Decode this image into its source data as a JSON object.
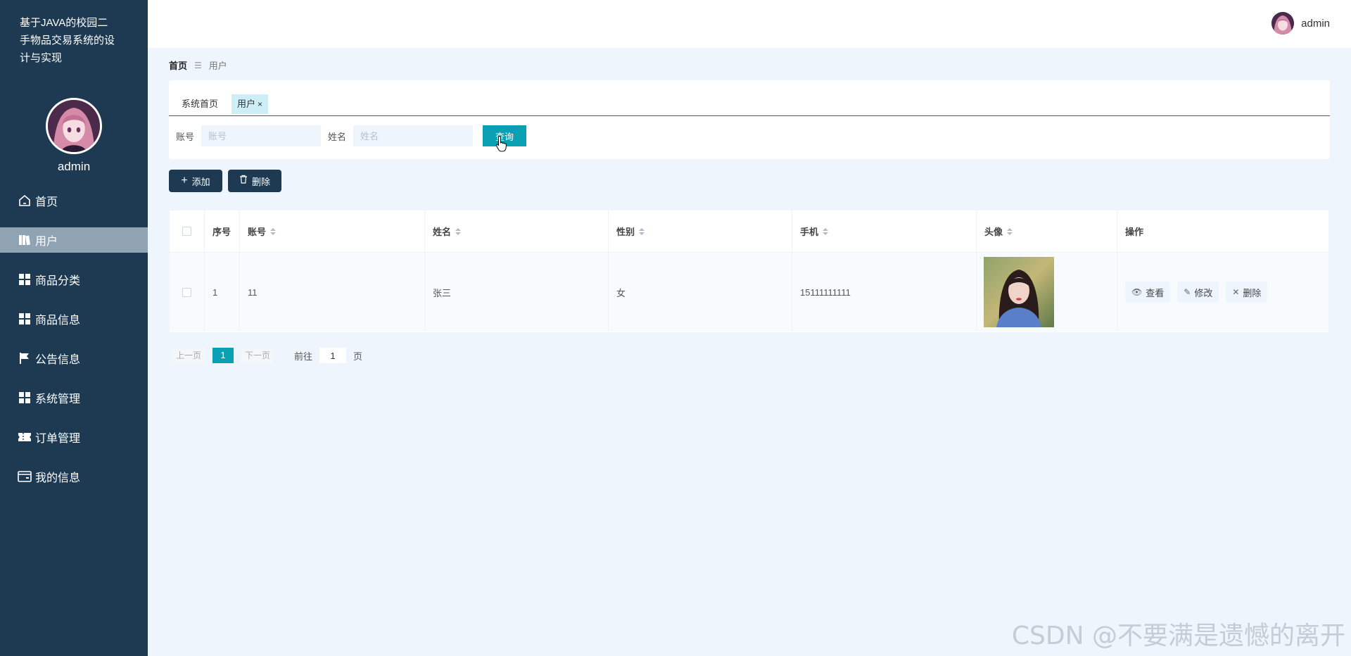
{
  "app": {
    "title": "基于JAVA的校园二手物品交易系统的设计与实现",
    "title_lines": [
      "基于JAVA的校园二",
      "手物品交易系统的设",
      "计与实现"
    ]
  },
  "sidebar": {
    "username": "admin",
    "items": [
      {
        "label": "首页",
        "icon": "home-icon",
        "active": false
      },
      {
        "label": "用户",
        "icon": "book-icon",
        "active": true
      },
      {
        "label": "商品分类",
        "icon": "grid-icon",
        "active": false
      },
      {
        "label": "商品信息",
        "icon": "grid-icon",
        "active": false
      },
      {
        "label": "公告信息",
        "icon": "flag-icon",
        "active": false
      },
      {
        "label": "系统管理",
        "icon": "grid-icon",
        "active": false
      },
      {
        "label": "订单管理",
        "icon": "ticket-icon",
        "active": false
      },
      {
        "label": "我的信息",
        "icon": "card-icon",
        "active": false
      }
    ]
  },
  "header": {
    "username": "admin"
  },
  "breadcrumb": {
    "home": "首页",
    "separator": "☰",
    "current": "用户"
  },
  "tabs": [
    {
      "label": "系统首页"
    },
    {
      "label": "用户",
      "close": "×"
    }
  ],
  "search": {
    "account_label": "账号",
    "account_placeholder": "账号",
    "name_label": "姓名",
    "name_placeholder": "姓名",
    "button": "查询"
  },
  "actions": {
    "add": "添加",
    "delete": "删除"
  },
  "table": {
    "headers": [
      "序号",
      "账号",
      "姓名",
      "性别",
      "手机",
      "头像",
      "操作"
    ],
    "rows": [
      {
        "index": "1",
        "account": "11",
        "name": "张三",
        "gender": "女",
        "phone": "15111111111"
      }
    ],
    "row_actions": {
      "view": "查看",
      "edit": "修改",
      "delete": "删除"
    }
  },
  "pagination": {
    "prev": "上一页",
    "current": "1",
    "next": "下一页",
    "goto_label": "前往",
    "goto_value": "1",
    "unit": "页"
  },
  "watermark": "CSDN @不要满是遗憾的离开",
  "colors": {
    "sidebar_bg": "#1d3a52",
    "accent": "#0aa0b4",
    "page_bg": "#eef5fc"
  }
}
